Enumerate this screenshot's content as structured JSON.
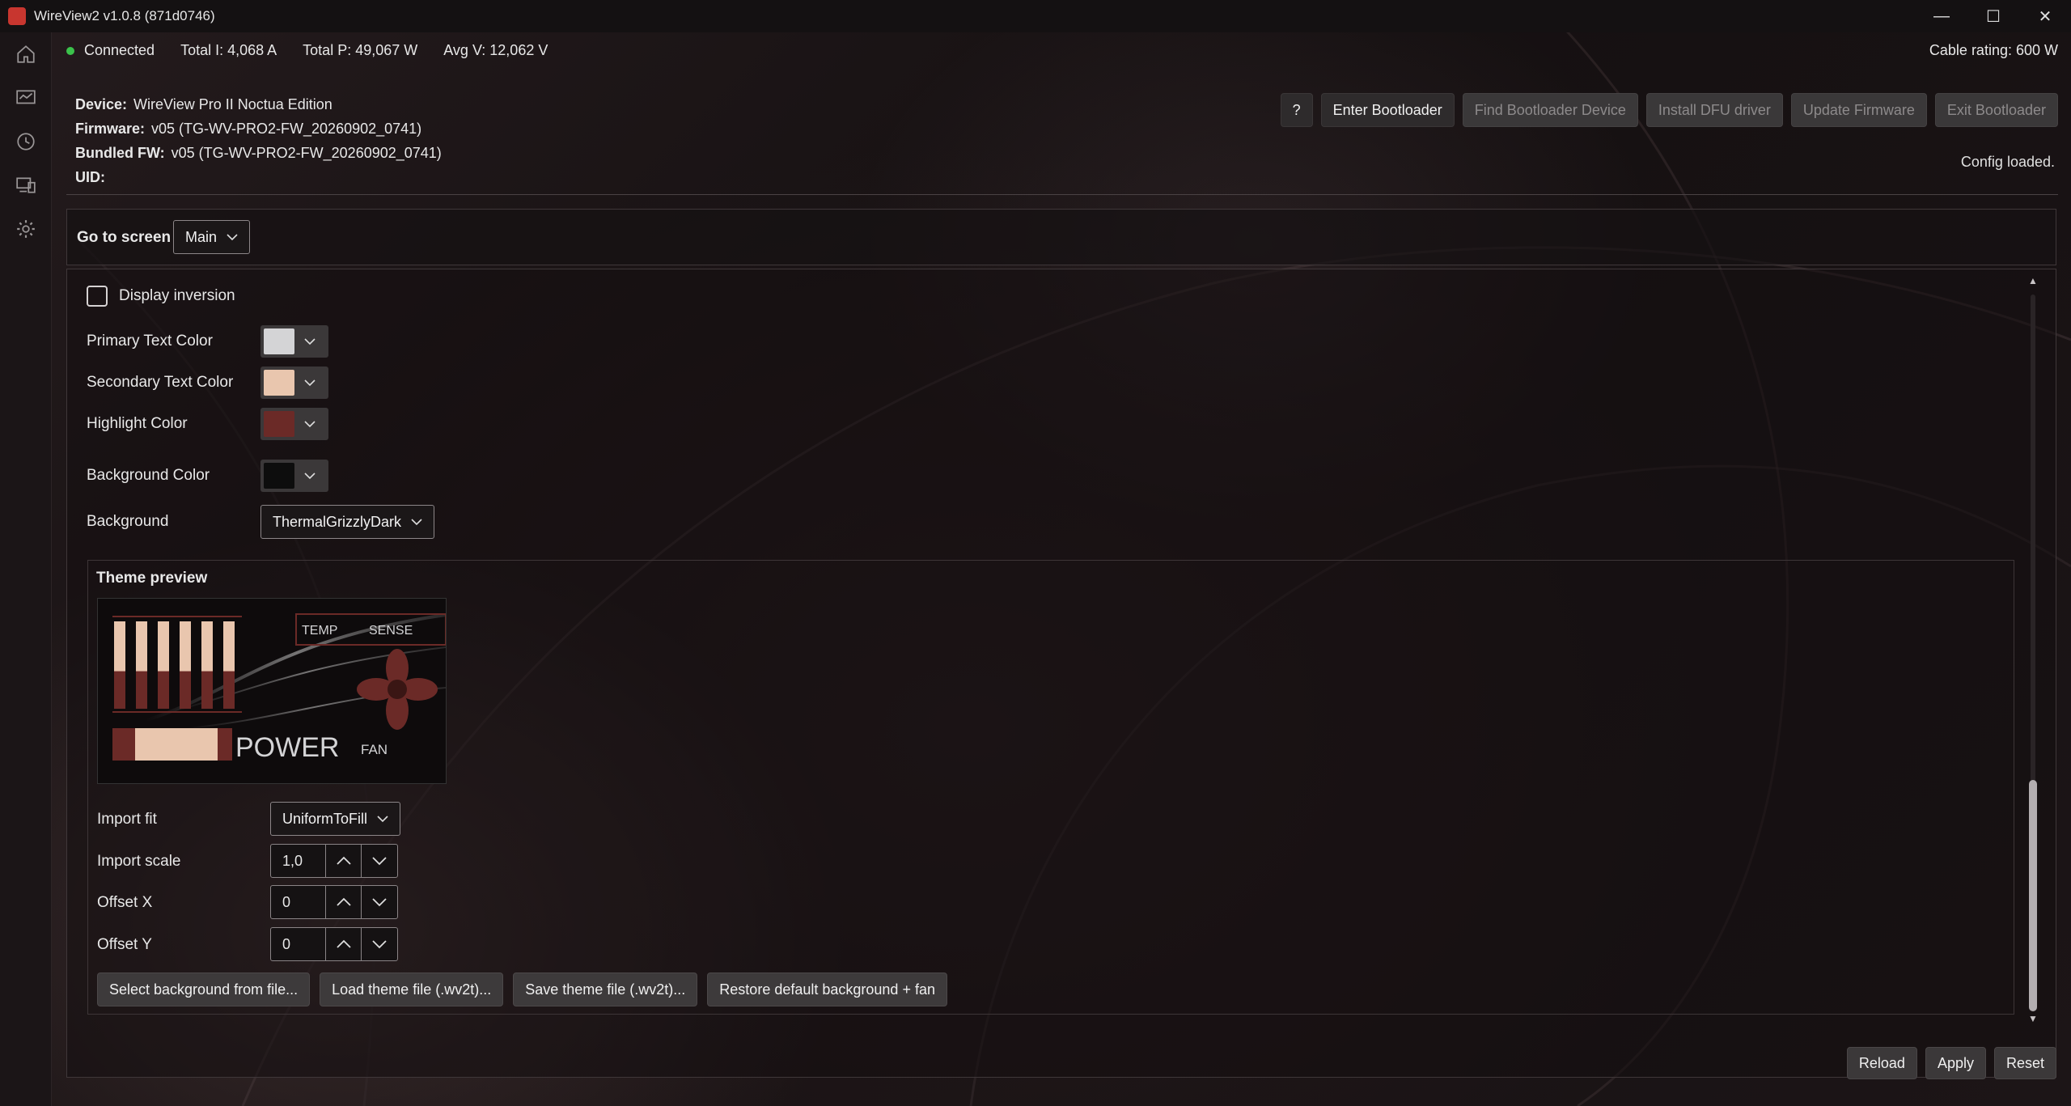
{
  "window": {
    "title": "WireView2 v1.0.8 (871d0746)",
    "controls": {
      "minimize": "—",
      "maximize": "☐",
      "close": "✕"
    }
  },
  "rail": {
    "items": [
      {
        "icon": "home-icon"
      },
      {
        "icon": "monitor-chart-icon"
      },
      {
        "icon": "history-icon"
      },
      {
        "icon": "devices-icon"
      },
      {
        "icon": "gear-icon"
      }
    ]
  },
  "status": {
    "connected": "Connected",
    "total_current": "Total I: 4,068 A",
    "total_power": "Total P: 49,067 W",
    "avg_voltage": "Avg V: 12,062 V",
    "cable_rating": "Cable rating: 600 W",
    "connected_color": "#3bc24b"
  },
  "device": {
    "device_label": "Device:",
    "device_value": "WireView Pro II Noctua Edition",
    "firmware_label": "Firmware:",
    "firmware_value": "v05  (TG-WV-PRO2-FW_20260902_0741)",
    "bundled_label": "Bundled FW:",
    "bundled_value": "v05  (TG-WV-PRO2-FW_20260902_0741)",
    "uid_label": "UID:",
    "uid_value": ""
  },
  "toolbar": {
    "help": "?",
    "enter_bootloader": "Enter Bootloader",
    "find_bootloader": "Find Bootloader Device",
    "install_dfu": "Install DFU driver",
    "update_firmware": "Update Firmware",
    "exit_bootloader": "Exit Bootloader",
    "config_status": "Config loaded."
  },
  "goto": {
    "label": "Go to screen",
    "selected": "Main"
  },
  "display": {
    "inversion_label": "Display inversion",
    "inversion_checked": false,
    "primary_text_label": "Primary Text Color",
    "primary_text_color": "#d4d4d6",
    "secondary_text_label": "Secondary Text Color",
    "secondary_text_color": "#e9c6ae",
    "highlight_label": "Highlight Color",
    "highlight_color": "#6b2a27",
    "background_color_label": "Background Color",
    "background_color": "#0d0d0d",
    "background_label": "Background",
    "background_selected": "ThermalGrizzlyDark"
  },
  "theme": {
    "title": "Theme preview",
    "preview": {
      "temp": "TEMP",
      "sense": "SENSE",
      "power": "POWER",
      "fan": "FAN",
      "bar_levels": [
        0.92,
        0.92,
        0.92,
        0.92,
        0.92,
        0.92
      ],
      "power_fill": 0.85
    },
    "import_fit_label": "Import fit",
    "import_fit_selected": "UniformToFill",
    "import_scale_label": "Import scale",
    "import_scale_value": "1,0",
    "offset_x_label": "Offset X",
    "offset_x_value": "0",
    "offset_y_label": "Offset Y",
    "offset_y_value": "0",
    "select_bg_button": "Select background from file...",
    "load_theme_button": "Load theme file (.wv2t)...",
    "save_theme_button": "Save theme file (.wv2t)...",
    "restore_button": "Restore default background + fan"
  },
  "footer": {
    "reload": "Reload",
    "apply": "Apply",
    "reset": "Reset"
  }
}
